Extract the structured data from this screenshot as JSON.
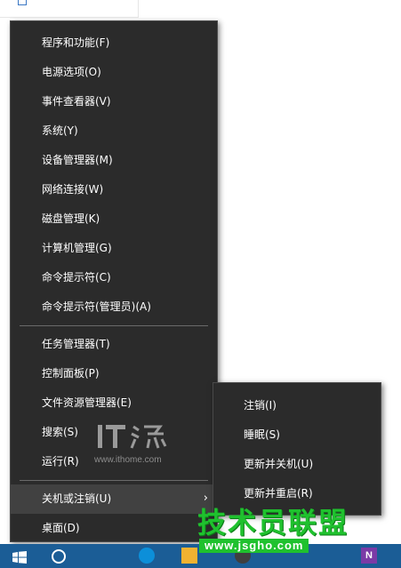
{
  "main_menu": {
    "items": [
      {
        "label": "程序和功能(F)"
      },
      {
        "label": "电源选项(O)"
      },
      {
        "label": "事件查看器(V)"
      },
      {
        "label": "系统(Y)"
      },
      {
        "label": "设备管理器(M)"
      },
      {
        "label": "网络连接(W)"
      },
      {
        "label": "磁盘管理(K)"
      },
      {
        "label": "计算机管理(G)"
      },
      {
        "label": "命令提示符(C)"
      },
      {
        "label": "命令提示符(管理员)(A)"
      },
      {
        "label": "任务管理器(T)"
      },
      {
        "label": "控制面板(P)"
      },
      {
        "label": "文件资源管理器(E)"
      },
      {
        "label": "搜索(S)"
      },
      {
        "label": "运行(R)"
      },
      {
        "label": "关机或注销(U)"
      },
      {
        "label": "桌面(D)"
      }
    ],
    "hovered_item": "关机或注销(U)"
  },
  "sub_menu": {
    "items": [
      {
        "label": "注销(I)"
      },
      {
        "label": "睡眠(S)"
      },
      {
        "label": "更新并关机(U)"
      },
      {
        "label": "更新并重启(R)"
      }
    ]
  },
  "watermarks": {
    "it_logo_text": "IT之家",
    "it_url": "www.ithome.com",
    "site_title": "技术员联盟",
    "site_url": "www.jsgho.com"
  },
  "taskbar": {
    "app_icons": [
      "start-icon",
      "search-icon",
      "browser-icon",
      "explorer-icon",
      "app-icon",
      "onenote-icon"
    ],
    "onenote_letter": "N"
  },
  "colors": {
    "menu_bg": "#2b2b2b",
    "menu_hover": "#414141",
    "menu_text": "#ffffff",
    "separator": "#6a6a6a",
    "taskbar": "#1b5d96",
    "watermark_green": "#1fc12e"
  }
}
